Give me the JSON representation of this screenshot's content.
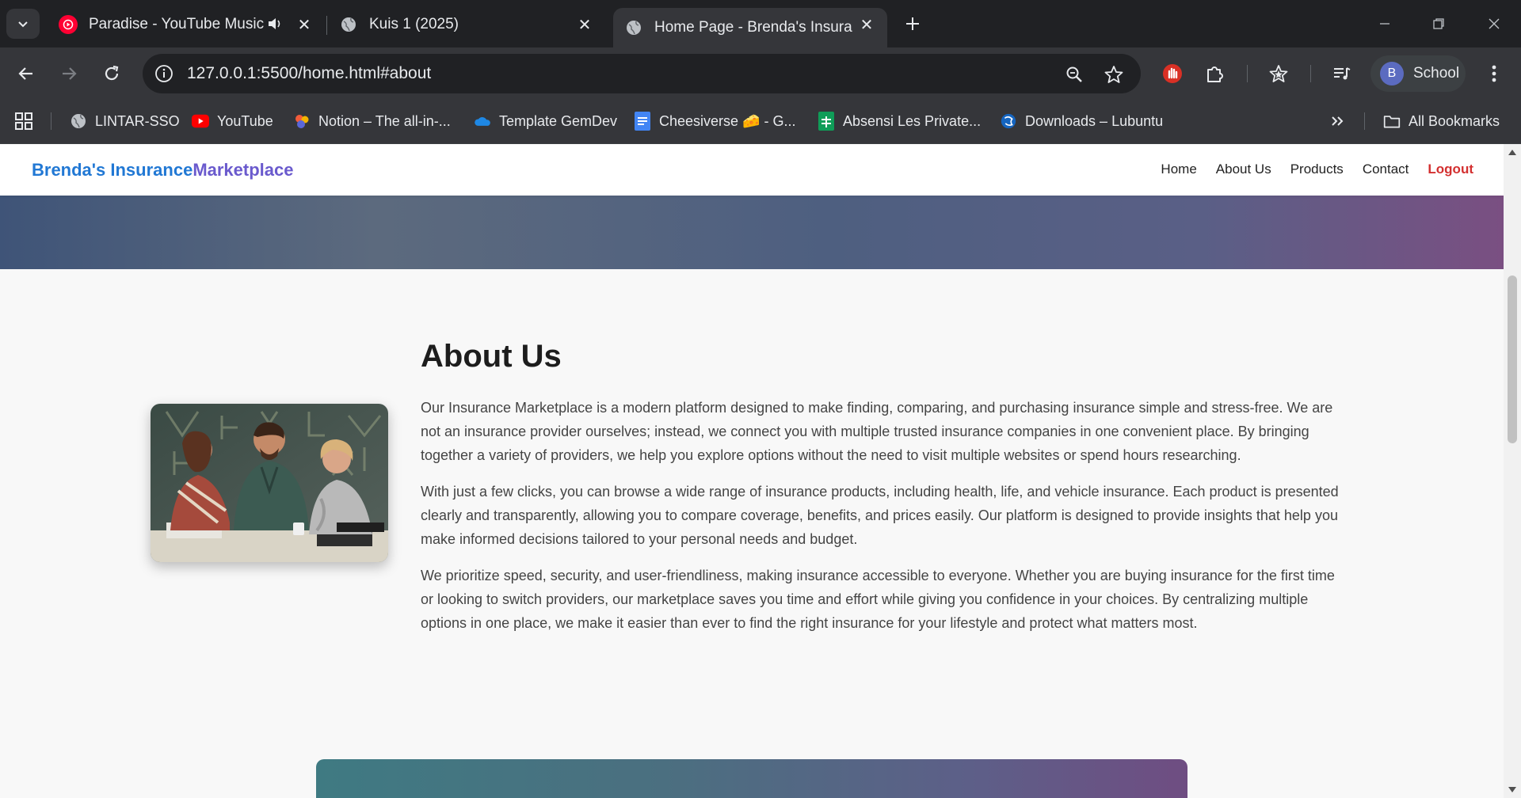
{
  "browser": {
    "tabs": [
      {
        "title": "Paradise - YouTube Music",
        "active": false,
        "audio": true
      },
      {
        "title": "Kuis 1 (2025)",
        "active": false
      },
      {
        "title": "Home Page - Brenda's Insuranc",
        "active": true
      }
    ],
    "url": "127.0.0.1:5500/home.html#about",
    "profile_initial": "B",
    "profile_name": "School",
    "bookmarks": [
      {
        "label": "LINTAR-SSO",
        "icon": "globe-icon"
      },
      {
        "label": "YouTube",
        "icon": "youtube-icon"
      },
      {
        "label": "Notion – The all-in-...",
        "icon": "notion-icon"
      },
      {
        "label": "Template GemDev",
        "icon": "onedrive-icon"
      },
      {
        "label": "Cheesiverse 🧀 - G...",
        "icon": "docs-icon"
      },
      {
        "label": "Absensi Les Private...",
        "icon": "sheets-icon"
      },
      {
        "label": "Downloads – Lubuntu",
        "icon": "lubuntu-icon"
      }
    ],
    "all_bookmarks": "All Bookmarks"
  },
  "site": {
    "brand_part1": "Brenda's Insurance",
    "brand_part2": "Marketplace",
    "nav": {
      "home": "Home",
      "about": "About Us",
      "products": "Products",
      "contact": "Contact",
      "logout": "Logout"
    }
  },
  "about": {
    "title": "About Us",
    "paragraphs": [
      "Our Insurance Marketplace is a modern platform designed to make finding, comparing, and purchasing insurance simple and stress-free. We are not an insurance provider ourselves; instead, we connect you with multiple trusted insurance companies in one convenient place. By bringing together a variety of providers, we help you explore options without the need to visit multiple websites or spend hours researching.",
      "With just a few clicks, you can browse a wide range of insurance products, including health, life, and vehicle insurance. Each product is presented clearly and transparently, allowing you to compare coverage, benefits, and prices easily. Our platform is designed to provide insights that help you make informed decisions tailored to your personal needs and budget.",
      "We prioritize speed, security, and user-friendliness, making insurance accessible to everyone. Whether you are buying insurance for the first time or looking to switch providers, our marketplace saves you time and effort while giving you confidence in your choices. By centralizing multiple options in one place, we make it easier than ever to find the right insurance for your lifestyle and protect what matters most."
    ]
  },
  "colors": {
    "brand_blue": "#2178d4",
    "brand_purple": "#6a5acd",
    "logout_red": "#d32f2f"
  }
}
